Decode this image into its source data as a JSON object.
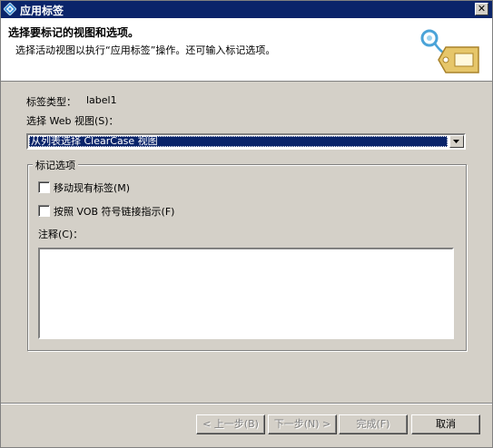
{
  "window": {
    "title": "应用标签",
    "close_glyph": "✕"
  },
  "banner": {
    "title": "选择要标记的视图和选项。",
    "description": "选择活动视图以执行“应用标签”操作。还可输入标记选项。",
    "icon": "tag-icon"
  },
  "form": {
    "label_type_label": "标签类型：",
    "label_type_value": "label1",
    "view_label": "选择 Web 视图(S)：",
    "view_combo_value": "从列表选择 ClearCase 视图",
    "group_title": "标记选项",
    "option_move": "移动现有标签(M)",
    "option_follow_symlink": "按照 VOB 符号链接指示(F)",
    "comment_label": "注释(C)：",
    "comment_value": "",
    "option_move_checked": false,
    "option_follow_symlink_checked": false
  },
  "buttons": {
    "back": "< 上一步(B)",
    "next": "下一步(N) >",
    "finish": "完成(F)",
    "cancel": "取消"
  },
  "colors": {
    "titlebar": "#0a246a",
    "face": "#d4d0c8",
    "selection": "#0a246a"
  }
}
